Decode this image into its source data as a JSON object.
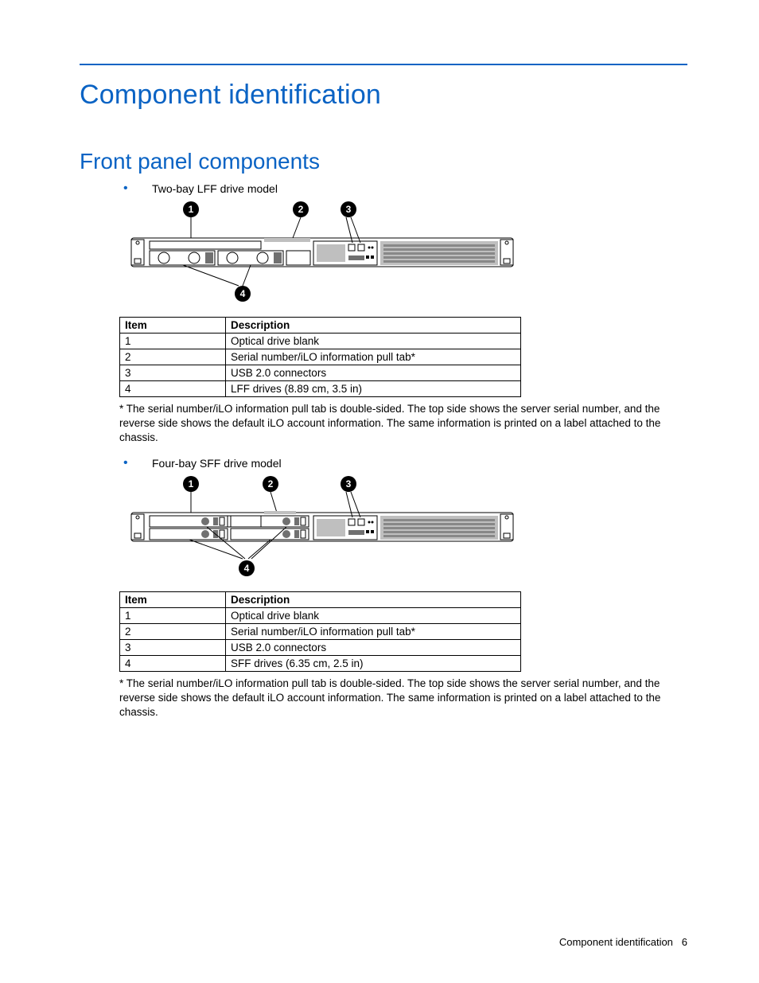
{
  "heading1": "Component identification",
  "heading2": "Front panel components",
  "section1": {
    "bullet": "Two-bay LFF drive model",
    "callouts": [
      "1",
      "2",
      "3",
      "4"
    ],
    "table": {
      "headers": [
        "Item",
        "Description"
      ],
      "rows": [
        [
          "1",
          "Optical drive blank"
        ],
        [
          "2",
          "Serial number/iLO information pull tab*"
        ],
        [
          "3",
          "USB 2.0 connectors"
        ],
        [
          "4",
          "LFF drives (8.89 cm, 3.5 in)"
        ]
      ]
    },
    "footnote": "* The serial number/iLO information pull tab is double-sided. The top side shows the server serial number, and the reverse side shows the default iLO account information. The same information is printed on a label attached to the chassis."
  },
  "section2": {
    "bullet": "Four-bay SFF drive model",
    "callouts": [
      "1",
      "2",
      "3",
      "4"
    ],
    "table": {
      "headers": [
        "Item",
        "Description"
      ],
      "rows": [
        [
          "1",
          "Optical drive blank"
        ],
        [
          "2",
          "Serial number/iLO information pull tab*"
        ],
        [
          "3",
          "USB 2.0 connectors"
        ],
        [
          "4",
          "SFF drives (6.35 cm, 2.5 in)"
        ]
      ]
    },
    "footnote": "* The serial number/iLO information pull tab is double-sided. The top side shows the server serial number, and the reverse side shows the default iLO account information. The same information is printed on a label attached to the chassis."
  },
  "footer": {
    "title": "Component identification",
    "page": "6"
  }
}
